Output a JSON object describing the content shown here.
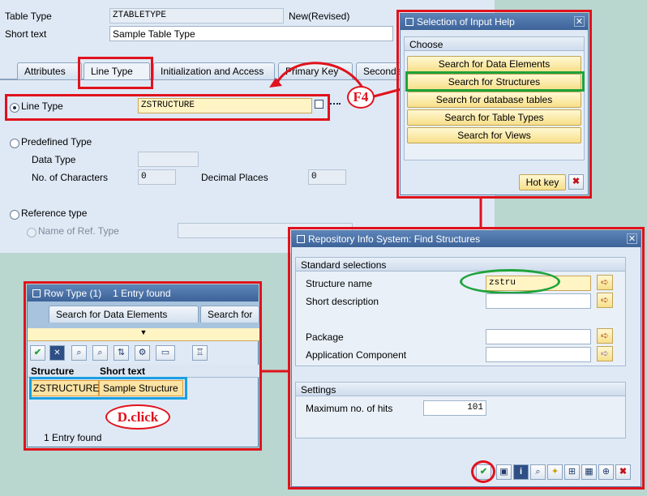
{
  "header": {
    "table_type_label": "Table Type",
    "table_type_value": "ZTABLETYPE",
    "status": "New(Revised)",
    "short_text_label": "Short text",
    "short_text_value": "Sample Table Type"
  },
  "tabs": [
    {
      "label": "Attributes"
    },
    {
      "label": "Line Type"
    },
    {
      "label": "Initialization and Access"
    },
    {
      "label": "Primary Key"
    },
    {
      "label": "Seconda"
    }
  ],
  "line_type": {
    "radio_label": "Line Type",
    "value": "ZSTRUCTURE",
    "predefined_label": "Predefined Type",
    "data_type_label": "Data Type",
    "num_chars_label": "No. of Characters",
    "num_chars_value": "0",
    "decimal_label": "Decimal Places",
    "decimal_value": "0",
    "reference_label": "Reference type",
    "ref_name_label": "Name of Ref. Type"
  },
  "annotations": {
    "f4": "F4",
    "dclick": "D.click"
  },
  "input_help": {
    "title": "Selection of Input Help",
    "group": "Choose",
    "options": [
      {
        "label": "Search for Data Elements"
      },
      {
        "label": "Search for Structures"
      },
      {
        "label": "Search for database tables"
      },
      {
        "label": "Search for Table Types"
      },
      {
        "label": "Search for Views"
      }
    ],
    "hot_key": "Hot key"
  },
  "find_structures": {
    "title": "Repository Info System: Find Structures",
    "std_group": "Standard selections",
    "structure_name_label": "Structure name",
    "structure_name_value": "zstru",
    "short_desc_label": "Short description",
    "package_label": "Package",
    "app_comp_label": "Application Component",
    "settings_group": "Settings",
    "max_hits_label": "Maximum no. of hits",
    "max_hits_value": "101"
  },
  "row_type": {
    "title": "Row Type (1)",
    "entries_found": "1 Entry found",
    "tabs": [
      {
        "label": "Search for Data Elements"
      },
      {
        "label": "Search for"
      }
    ],
    "columns": [
      "Structure",
      "Short text"
    ],
    "rows": [
      {
        "structure": "ZSTRUCTURE",
        "short_text": "Sample Structure"
      }
    ],
    "footer": "1 Entry found"
  },
  "colors": {
    "annotation_red": "#e0121d",
    "annotation_green": "#1ea33a",
    "annotation_blue": "#1aa0e0",
    "sap_title_blue": "#3d6399",
    "required_yellow": "#fff4c4"
  }
}
